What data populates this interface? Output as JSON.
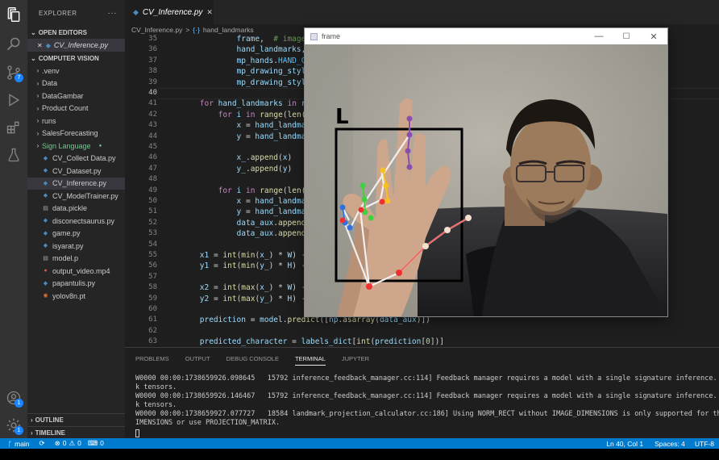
{
  "activity_bar": {
    "scm_badge": "7",
    "accounts_badge": "1",
    "manage_badge": "1"
  },
  "sidebar": {
    "title": "EXPLORER",
    "more": "···",
    "open_editors_label": "OPEN EDITORS",
    "open_editor_file": "CV_Inference.py",
    "project_label": "COMPUTER VISION",
    "tree": [
      {
        "label": ".venv",
        "type": "folder"
      },
      {
        "label": "Data",
        "type": "folder"
      },
      {
        "label": "DataGambar",
        "type": "folder"
      },
      {
        "label": "Product Count",
        "type": "folder"
      },
      {
        "label": "runs",
        "type": "folder"
      },
      {
        "label": "SalesForecasting",
        "type": "folder"
      },
      {
        "label": "Sign Language",
        "type": "folder-modified"
      },
      {
        "label": "CV_Collect Data.py",
        "type": "py"
      },
      {
        "label": "CV_Dataset.py",
        "type": "py"
      },
      {
        "label": "CV_Inference.py",
        "type": "py-selected"
      },
      {
        "label": "CV_ModelTrainer.py",
        "type": "py"
      },
      {
        "label": "data.pickle",
        "type": "file"
      },
      {
        "label": "disconectsaurus.py",
        "type": "py"
      },
      {
        "label": "game.py",
        "type": "py"
      },
      {
        "label": "isyarat.py",
        "type": "py"
      },
      {
        "label": "model.p",
        "type": "file"
      },
      {
        "label": "output_video.mp4",
        "type": "video"
      },
      {
        "label": "papantulis.py",
        "type": "py"
      },
      {
        "label": "yolov8n.pt",
        "type": "pt"
      }
    ],
    "outline_label": "OUTLINE",
    "timeline_label": "TIMELINE"
  },
  "tabs": [
    {
      "label": "CV_Inference.py",
      "close": "✕"
    }
  ],
  "breadcrumb": {
    "file": "CV_Inference.py",
    "separator": ">",
    "symbol": "hand_landmarks"
  },
  "editor": {
    "current_line": "40",
    "lines": [
      {
        "n": "35",
        "t": "                frame,  # image"
      },
      {
        "n": "36",
        "t": "                hand_landmarks,"
      },
      {
        "n": "37",
        "t": "                mp_hands.HAND_CO"
      },
      {
        "n": "38",
        "t": "                mp_drawing_style"
      },
      {
        "n": "39",
        "t": "                mp_drawing_style"
      },
      {
        "n": "40",
        "t": ""
      },
      {
        "n": "41",
        "t": "        for hand_landmarks in re"
      },
      {
        "n": "42",
        "t": "            for i in range(len(h"
      },
      {
        "n": "43",
        "t": "                x = hand_landmar"
      },
      {
        "n": "44",
        "t": "                y = hand_landmar"
      },
      {
        "n": "45",
        "t": ""
      },
      {
        "n": "46",
        "t": "                x_.append(x)"
      },
      {
        "n": "47",
        "t": "                y_.append(y)"
      },
      {
        "n": "48",
        "t": ""
      },
      {
        "n": "49",
        "t": "            for i in range(len(h"
      },
      {
        "n": "50",
        "t": "                x = hand_landmar"
      },
      {
        "n": "51",
        "t": "                y = hand_landmar"
      },
      {
        "n": "52",
        "t": "                data_aux.append("
      },
      {
        "n": "53",
        "t": "                data_aux.append("
      },
      {
        "n": "54",
        "t": ""
      },
      {
        "n": "55",
        "t": "        x1 = int(min(x_) * W) -"
      },
      {
        "n": "56",
        "t": "        y1 = int(min(y_) * H) -"
      },
      {
        "n": "57",
        "t": ""
      },
      {
        "n": "58",
        "t": "        x2 = int(max(x_) * W) -"
      },
      {
        "n": "59",
        "t": "        y2 = int(max(y_) * H) -"
      },
      {
        "n": "60",
        "t": ""
      },
      {
        "n": "61",
        "t": "        prediction = model.predict([np.asarray(data_aux)])"
      },
      {
        "n": "62",
        "t": ""
      },
      {
        "n": "63",
        "t": "        predicted_character = labels_dict[int(prediction[0])]"
      }
    ]
  },
  "frame_window": {
    "title": "frame",
    "prediction_label": "L",
    "colors": {
      "box": "#000000",
      "thumb": "#ff3030",
      "index": "#8a4fae",
      "middle": "#f5c020",
      "ring": "#40d040",
      "pinky": "#3070e0"
    }
  },
  "panel": {
    "tabs": [
      "PROBLEMS",
      "OUTPUT",
      "DEBUG CONSOLE",
      "TERMINAL",
      "JUPYTER"
    ],
    "active_tab": "TERMINAL",
    "terminal_lines": [
      "W0000 00:00:1738659926.098645   15792 inference_feedback_manager.cc:114] Feedback manager requires a model with a single signature inference. D",
      "k tensors.",
      "W0000 00:00:1738659926.146467   15792 inference_feedback_manager.cc:114] Feedback manager requires a model with a single signature inference. D",
      "k tensors.",
      "W0000 00:00:1738659927.077727   18584 landmark_projection_calculator.cc:186] Using NORM_RECT without IMAGE_DIMENSIONS is only supported for the",
      "IMENSIONS or use PROJECTION_MATRIX."
    ]
  },
  "status_bar": {
    "branch": "main",
    "errors": "0",
    "warnings": "0",
    "ports": "0",
    "position": "Ln 40, Col 1",
    "spaces": "Spaces: 4",
    "encoding": "UTF-8"
  }
}
